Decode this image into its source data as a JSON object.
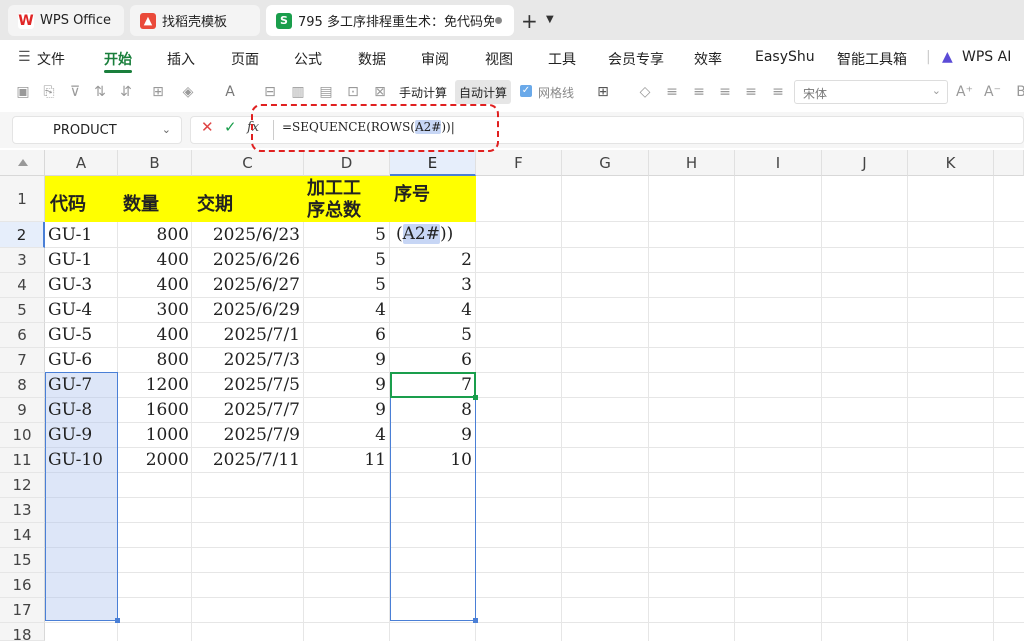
{
  "tabs": [
    {
      "label": "WPS Office",
      "icon": "wps-logo-icon"
    },
    {
      "label": "找稻壳模板",
      "icon": "docer-icon"
    },
    {
      "label": "795 多工序排程重生术：免代码免",
      "icon": "spreadsheet-icon",
      "icon_glyph": "S"
    }
  ],
  "menu": {
    "file": "文件",
    "items": [
      "开始",
      "插入",
      "页面",
      "公式",
      "数据",
      "审阅",
      "视图",
      "工具",
      "会员专享",
      "效率",
      "EasyShu",
      "智能工具箱"
    ],
    "ai": "WPS AI"
  },
  "toolbar": {
    "manual_calc": "手动计算",
    "auto_calc": "自动计算",
    "gridlines": "网格线",
    "font": "宋体"
  },
  "formula_bar": {
    "name_box": "PRODUCT",
    "fx": "fx",
    "formula_prefix": "=SEQUENCE(ROWS(",
    "formula_ref": "A2#",
    "formula_suffix": "))"
  },
  "sheet": {
    "columns": [
      "A",
      "B",
      "C",
      "D",
      "E",
      "F",
      "G",
      "H",
      "I",
      "J",
      "K"
    ],
    "rows": [
      "1",
      "2",
      "3",
      "4",
      "5",
      "6",
      "7",
      "8",
      "9",
      "10",
      "11",
      "12",
      "13",
      "14",
      "15",
      "16",
      "17",
      "18"
    ],
    "header": {
      "code": "代码",
      "qty": "数量",
      "due": "交期",
      "proc_line1": "加工工",
      "proc_line2": "序总数",
      "seq": "序号"
    },
    "data": [
      {
        "code": "GU-1",
        "qty": "800",
        "due": "2025/6/23",
        "proc": "5"
      },
      {
        "code": "GU-1",
        "qty": "400",
        "due": "2025/6/26",
        "proc": "5",
        "seq": "2"
      },
      {
        "code": "GU-3",
        "qty": "400",
        "due": "2025/6/27",
        "proc": "5",
        "seq": "3"
      },
      {
        "code": "GU-4",
        "qty": "300",
        "due": "2025/6/29",
        "proc": "4",
        "seq": "4"
      },
      {
        "code": "GU-5",
        "qty": "400",
        "due": "2025/7/1",
        "proc": "6",
        "seq": "5"
      },
      {
        "code": "GU-6",
        "qty": "800",
        "due": "2025/7/3",
        "proc": "9",
        "seq": "6"
      },
      {
        "code": "GU-7",
        "qty": "1200",
        "due": "2025/7/5",
        "proc": "9",
        "seq": "7"
      },
      {
        "code": "GU-8",
        "qty": "1600",
        "due": "2025/7/7",
        "proc": "9",
        "seq": "8"
      },
      {
        "code": "GU-9",
        "qty": "1000",
        "due": "2025/7/9",
        "proc": "4",
        "seq": "9"
      },
      {
        "code": "GU-10",
        "qty": "2000",
        "due": "2025/7/11",
        "proc": "11",
        "seq": "10"
      }
    ],
    "editing_cell": {
      "open": "(",
      "ref": "A2#",
      "close": "))"
    }
  },
  "colors": {
    "accent": "#1a7f3c",
    "header_fill": "#ffff00",
    "selection": "#4a7fd6",
    "annotation": "#e02020"
  }
}
